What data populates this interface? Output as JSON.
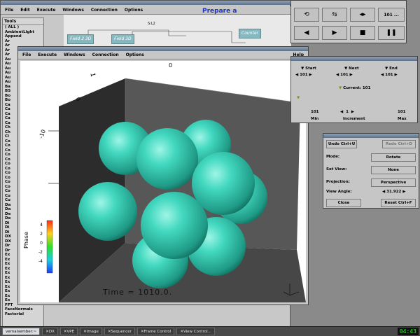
{
  "main_window": {
    "title": "",
    "menu": [
      "File",
      "Edit",
      "Execute",
      "Windows",
      "Connection",
      "Options"
    ],
    "nodes": [
      "Field 2 3D",
      "Field 3D",
      "Counter",
      "S:L2"
    ],
    "prepare_text": "Prepare a",
    "tools_header": "Tools",
    "tools": [
      "( ALL )",
      "AmbientLight",
      "Append",
      "Ar",
      "Ar",
      "Ar",
      "Ar",
      "Au",
      "Au",
      "Au",
      "Au",
      "Au",
      "Au",
      "Ba",
      "BS",
      "Bo",
      "Bo",
      "Ca",
      "Ca",
      "Ca",
      "Ca",
      "Ca",
      "Ch",
      "Ch",
      "Cl",
      "Co",
      "Co",
      "Co",
      "Co",
      "Co",
      "Co",
      "Co",
      "Co",
      "Co",
      "Co",
      "Co",
      "Co",
      "Cu",
      "Cu",
      "Da",
      "Da",
      "De",
      "De",
      "Di",
      "Di",
      "Di",
      "DX",
      "DX",
      "Dr",
      "Dr",
      "Ex",
      "Ex",
      "Ex",
      "Ex",
      "Ex",
      "Ex",
      "Ex",
      "Ex",
      "Ex",
      "Ex",
      "Ex",
      "FFT",
      "FaceNormals",
      "Factorial"
    ]
  },
  "image_window": {
    "menu": [
      "File",
      "Execute",
      "Windows",
      "Connection",
      "Options"
    ],
    "help": "Help",
    "time_label": "Time = 1010.0.",
    "colorbar": {
      "label": "Phase",
      "ticks": [
        "4",
        "2",
        "0",
        "-2",
        "-4"
      ]
    },
    "axis_labels": {
      "top_a": "1",
      "top_b": "0",
      "mid": "0",
      "left": "-10"
    }
  },
  "sequencer": {
    "frame": "101",
    "menu_dots": "..."
  },
  "frame_control": {
    "start_label": "Start",
    "next_label": "Next",
    "end_label": "End",
    "start_value": "101",
    "next_value": "101",
    "end_value": "101",
    "current_label": "Current: 101",
    "min_value": "101",
    "min_label": "Min",
    "increment_value": "1",
    "increment_label": "Increment",
    "max_value": "101",
    "max_label": "Max"
  },
  "view_control": {
    "undo_label": "Undo Ctrl+U",
    "redo_label": "Redo Ctrl+D",
    "mode_label": "Mode:",
    "mode_value": "Rotate",
    "set_view_label": "Set View:",
    "set_view_value": "None",
    "projection_label": "Projection:",
    "projection_value": "Perspective",
    "view_angle_label": "View Angle:",
    "view_angle_value": "31.922",
    "close_label": "Close",
    "reset_label": "Reset  Ctrl+F"
  },
  "taskbar": {
    "tasks": [
      "vernalsember:~",
      "DX",
      "VPE",
      "Image",
      "Sequencer",
      "Frame Control",
      "View Control..."
    ],
    "clock": "04:43"
  },
  "colors": {
    "sphere": "#43d8c0",
    "box_dark": "#2f2f2f",
    "box_light": "#5c5c5c",
    "accent_text": "#1c33c8"
  }
}
